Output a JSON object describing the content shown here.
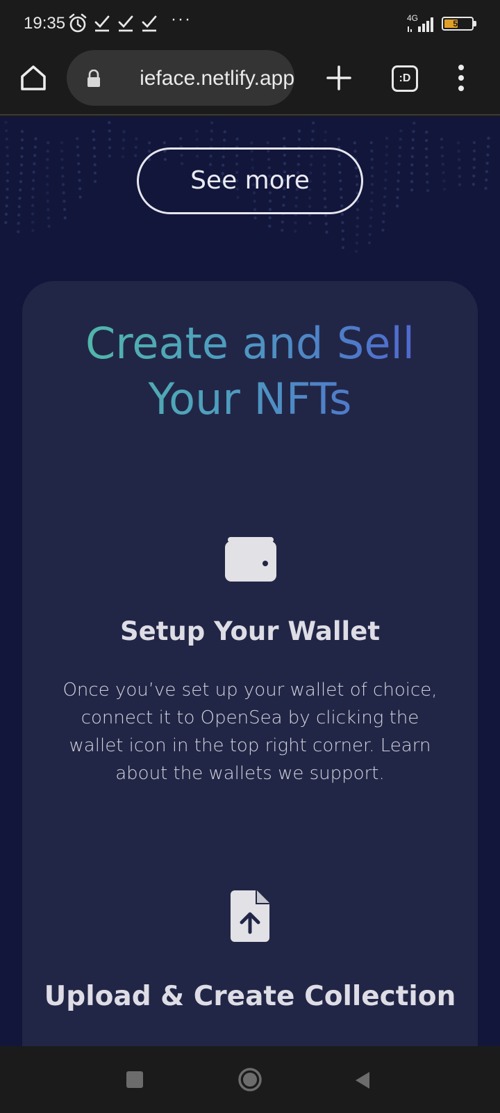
{
  "status_bar": {
    "time": "19:35",
    "icons": [
      "alarm-icon",
      "check-icon",
      "check-icon",
      "check-icon"
    ],
    "more": "···",
    "network": "4G",
    "battery": "51",
    "battery_level": 0.51
  },
  "browser": {
    "url": "ieface.netlify.app",
    "tab_switcher_label": ":D",
    "icons": [
      "home-icon",
      "lock-icon",
      "plus-icon",
      "tab-switcher-icon",
      "more-vert-icon"
    ]
  },
  "page": {
    "see_more_label": "See more",
    "section_title_line1": "Create and Sell",
    "section_title_line2": "Your NFTs",
    "gradient_colors": [
      "#52c2a0",
      "#4e9cc0",
      "#5058d4"
    ],
    "steps": [
      {
        "icon": "wallet-icon",
        "title": "Setup Your Wallet",
        "description": "Once you’ve set up your wallet of choice, connect it to OpenSea by clicking the wallet icon in the top right corner. Learn about the wallets we support."
      },
      {
        "icon": "file-upload-icon",
        "title": "Upload & Create Collection"
      }
    ]
  },
  "nav_bar": {
    "icons": [
      "recents-square-icon",
      "home-circle-icon",
      "back-triangle-icon"
    ]
  },
  "colors": {
    "page_bg": "#12163a",
    "card_bg": "#222646",
    "system_bar": "#1b1b1b"
  }
}
